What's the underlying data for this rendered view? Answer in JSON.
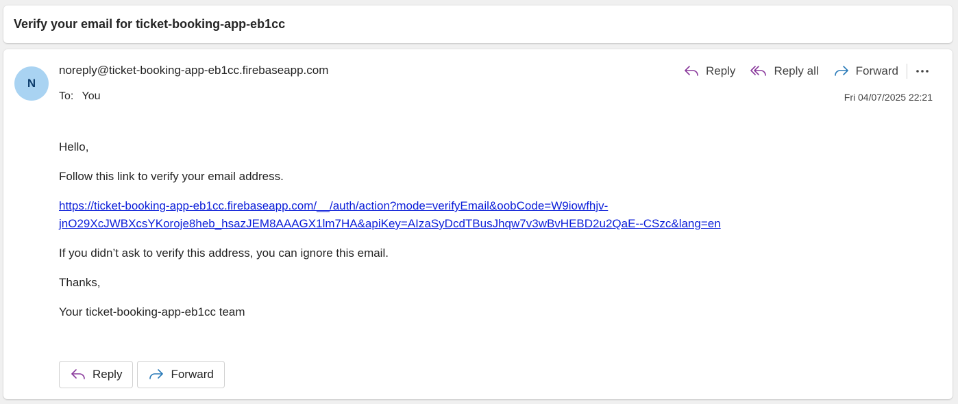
{
  "subject": "Verify your email for ticket-booking-app-eb1cc",
  "message": {
    "avatar_initial": "N",
    "sender": "noreply@ticket-booking-app-eb1cc.firebaseapp.com",
    "to_label": "To:",
    "to_value": "You",
    "date": "Fri 04/07/2025 22:21",
    "actions": {
      "reply": "Reply",
      "reply_all": "Reply all",
      "forward": "Forward"
    },
    "body": {
      "greeting": "Hello,",
      "instruction": "Follow this link to verify your email address.",
      "link_line1": "https://ticket-booking-app-eb1cc.firebaseapp.com/__/auth/action?mode=verifyEmail&oobCode=W9iowfhjv-",
      "link_line2": "jnO29XcJWBXcsYKoroje8heb_hsazJEM8AAAGX1lm7HA&apiKey=AIzaSyDcdTBusJhqw7v3wBvHEBD2u2QaE--CSzc&lang=en",
      "ignore_note": "If you didn’t ask to verify this address, you can ignore this email.",
      "thanks": "Thanks,",
      "signature": "Your ticket-booking-app-eb1cc team"
    },
    "bottom_buttons": {
      "reply": "Reply",
      "forward": "Forward"
    }
  },
  "icons": {
    "reply": "reply-icon",
    "reply_all": "reply-all-icon",
    "forward": "forward-icon",
    "more": "more-horizontal-icon"
  },
  "colors": {
    "reply_icon": "#8a3a9c",
    "forward_icon": "#2a7ab8",
    "link": "#0b1ed9",
    "avatar_bg": "#a9d3f2"
  }
}
